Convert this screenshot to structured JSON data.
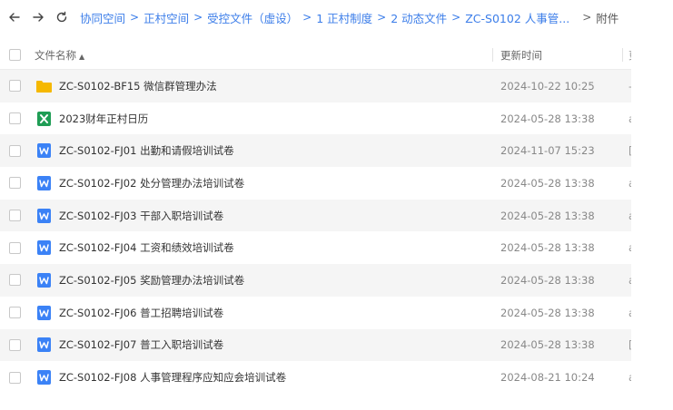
{
  "nav": {
    "back_icon": "arrow-left-icon",
    "forward_icon": "arrow-right-icon",
    "refresh_icon": "refresh-icon",
    "breadcrumbs": [
      "协同空间",
      "正村空间",
      "受控文件（虚设）",
      "1 正村制度",
      "2 动态文件",
      "ZC-S0102 人事管...",
      "附件"
    ],
    "separator": ">"
  },
  "table": {
    "columns": {
      "name": "文件名称",
      "updated": "更新时间",
      "third_partial": "更"
    },
    "rows": [
      {
        "type": "folder",
        "icon": "folder-icon",
        "name": "ZC-S0102-BF15 微信群管理办法",
        "updated": "2024-10-22 10:25",
        "extra": "-"
      },
      {
        "type": "excel",
        "icon": "excel-icon",
        "name": "2023财年正村日历",
        "updated": "2024-05-28 13:38",
        "extra": "a"
      },
      {
        "type": "word",
        "icon": "word-icon",
        "name": "ZC-S0102-FJ01 出勤和请假培训试卷",
        "updated": "2024-11-07 15:23",
        "extra": "["
      },
      {
        "type": "word",
        "icon": "word-icon",
        "name": "ZC-S0102-FJ02 处分管理办法培训试卷",
        "updated": "2024-05-28 13:38",
        "extra": "a"
      },
      {
        "type": "word",
        "icon": "word-icon",
        "name": "ZC-S0102-FJ03 干部入职培训试卷",
        "updated": "2024-05-28 13:38",
        "extra": "a"
      },
      {
        "type": "word",
        "icon": "word-icon",
        "name": "ZC-S0102-FJ04 工资和绩效培训试卷",
        "updated": "2024-05-28 13:38",
        "extra": "a"
      },
      {
        "type": "word",
        "icon": "word-icon",
        "name": "ZC-S0102-FJ05 奖励管理办法培训试卷",
        "updated": "2024-05-28 13:38",
        "extra": "a"
      },
      {
        "type": "word",
        "icon": "word-icon",
        "name": "ZC-S0102-FJ06 普工招聘培训试卷",
        "updated": "2024-05-28 13:38",
        "extra": "a"
      },
      {
        "type": "word",
        "icon": "word-icon",
        "name": "ZC-S0102-FJ07 普工入职培训试卷",
        "updated": "2024-05-28 13:38",
        "extra": "["
      },
      {
        "type": "word",
        "icon": "word-icon",
        "name": "ZC-S0102-FJ08 人事管理程序应知应会培训试卷",
        "updated": "2024-08-21 10:24",
        "extra": "a"
      }
    ]
  },
  "colors": {
    "link": "#3b7de9",
    "folder": "#f5b800",
    "excel": "#1f9d55",
    "word": "#3b82f6",
    "zebra": "#f5f5f5"
  }
}
